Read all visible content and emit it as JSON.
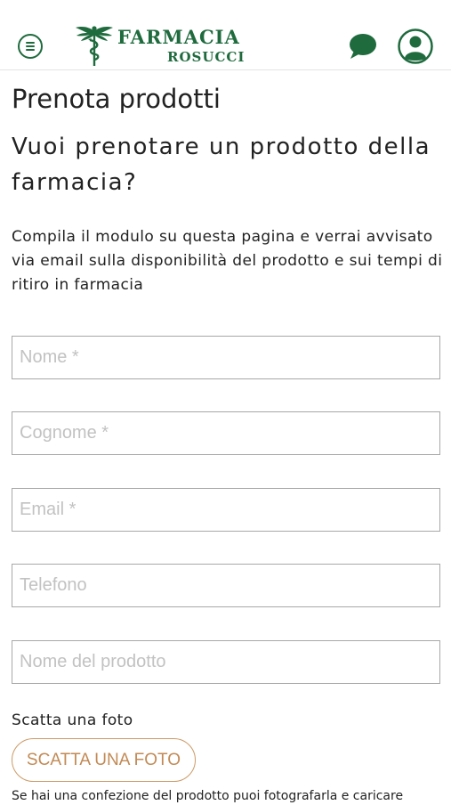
{
  "header": {
    "menu_icon": "menu-icon",
    "logo_name": "FARMACIA",
    "logo_sub": "ROSUCCI",
    "logo_icon": "caduceus-icon",
    "chat_icon": "chat-bubble-icon",
    "user_icon": "user-avatar-icon",
    "brand_color": "#1f6b3e"
  },
  "page": {
    "title": "Prenota prodotti",
    "headline": "Vuoi prenotare un prodotto della farmacia?",
    "intro": "Compila il modulo su questa pagina e verrai avvisato via email sulla disponibilità del prodotto e sui tempi di ritiro in farmacia"
  },
  "form": {
    "nome_placeholder": "Nome *",
    "cognome_placeholder": "Cognome *",
    "email_placeholder": "Email *",
    "telefono_placeholder": "Telefono",
    "prodotto_placeholder": "Nome del prodotto",
    "photo_label": "Scatta una foto",
    "photo_button": "SCATTA UNA FOTO",
    "photo_help": "Se hai una confezione del prodotto puoi fotografarla e caricare",
    "accent_color": "#c28a55"
  }
}
